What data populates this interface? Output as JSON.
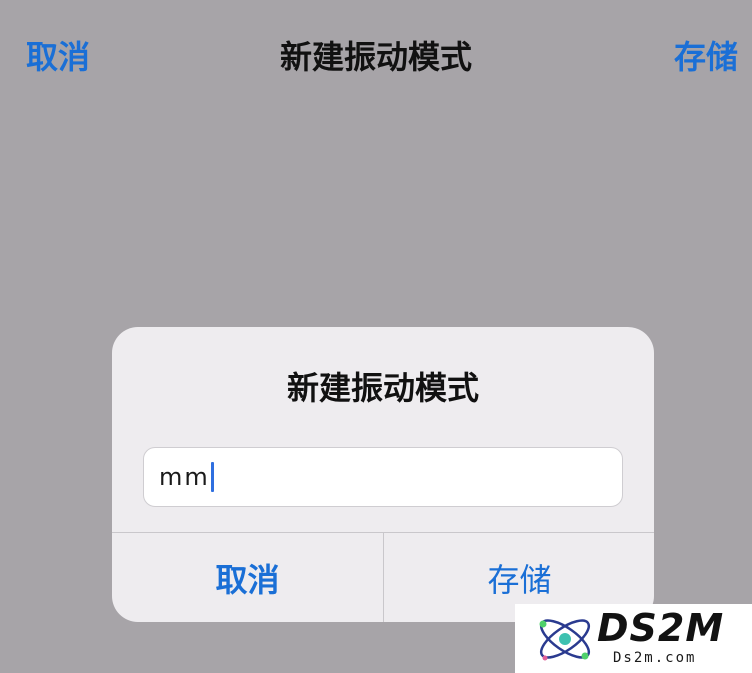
{
  "nav": {
    "cancel_label": "取消",
    "title": "新建振动模式",
    "save_label": "存储"
  },
  "alert": {
    "title": "新建振动模式",
    "input_value": "mm",
    "cancel_label": "取消",
    "save_label": "存储"
  },
  "watermark": {
    "brand": "DS2M",
    "site": "Ds2m.com"
  },
  "colors": {
    "accent": "#1a6fd6",
    "backdrop": "#a7a4a8",
    "alert_bg": "#eeecef"
  }
}
